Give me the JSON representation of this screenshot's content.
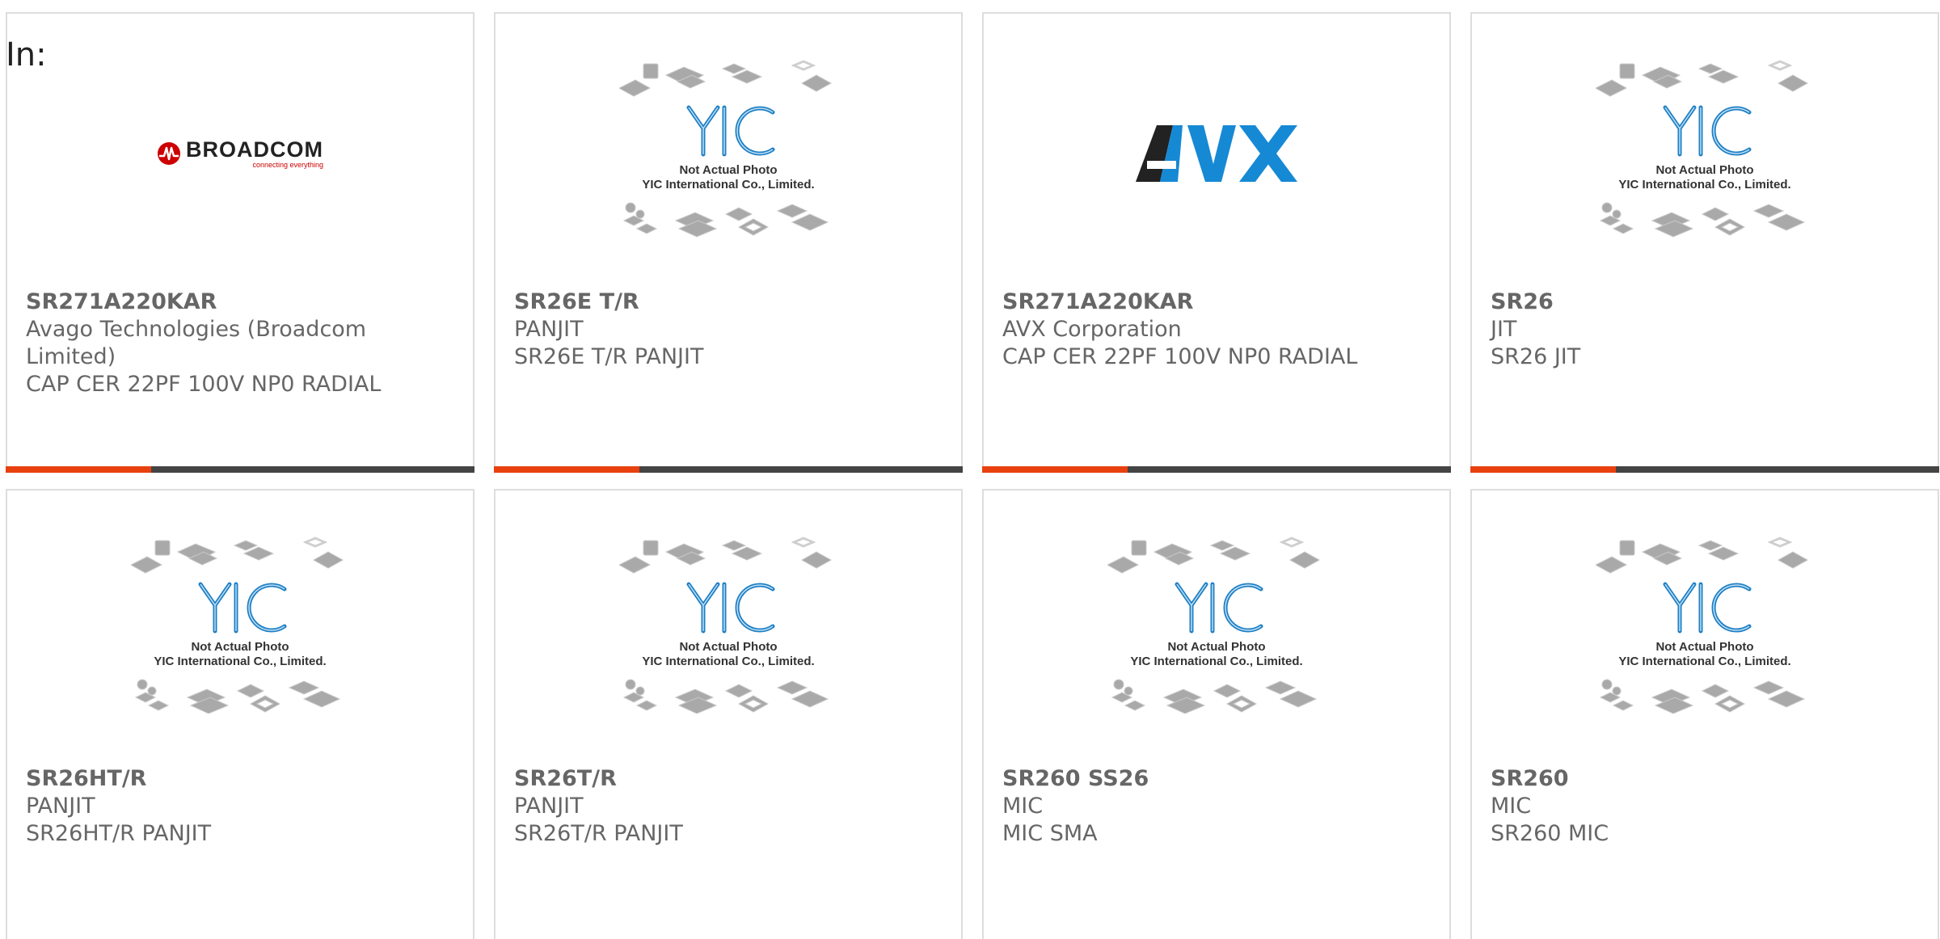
{
  "page": {
    "heading": "In:"
  },
  "placeholder": {
    "caption_line1": "Not Actual Photo",
    "caption_line2": "YIC International Co., Limited.",
    "logo_text": "YIC"
  },
  "brands": {
    "broadcom": {
      "name": "BROADCOM",
      "tagline": "connecting everything"
    },
    "avx": {
      "name": "AVX"
    }
  },
  "colors": {
    "accent": "#e8410f",
    "bar": "#444444",
    "text": "#666666",
    "border": "#dddddd",
    "yic_blue": "#1e7fc4",
    "broadcom_red": "#cc0000",
    "avx_blue": "#1689d5"
  },
  "products": [
    {
      "image": "broadcom-logo",
      "part": "SR271A220KAR",
      "manufacturer": "Avago Technologies (Broadcom Limited)",
      "description": "CAP CER 22PF 100V NP0 RADIAL"
    },
    {
      "image": "yic-placeholder",
      "part": "SR26E T/R",
      "manufacturer": "PANJIT",
      "description": "SR26E T/R PANJIT"
    },
    {
      "image": "avx-logo",
      "part": "SR271A220KAR",
      "manufacturer": "AVX Corporation",
      "description": "CAP CER 22PF 100V NP0 RADIAL"
    },
    {
      "image": "yic-placeholder",
      "part": "SR26",
      "manufacturer": "JIT",
      "description": "SR26 JIT"
    },
    {
      "image": "yic-placeholder",
      "part": "SR26HT/R",
      "manufacturer": "PANJIT",
      "description": "SR26HT/R PANJIT"
    },
    {
      "image": "yic-placeholder",
      "part": "SR26T/R",
      "manufacturer": "PANJIT",
      "description": "SR26T/R PANJIT"
    },
    {
      "image": "yic-placeholder",
      "part": "SR260 SS26",
      "manufacturer": "MIC",
      "description": "MIC SMA"
    },
    {
      "image": "yic-placeholder",
      "part": "SR260",
      "manufacturer": "MIC",
      "description": "SR260 MIC"
    }
  ]
}
